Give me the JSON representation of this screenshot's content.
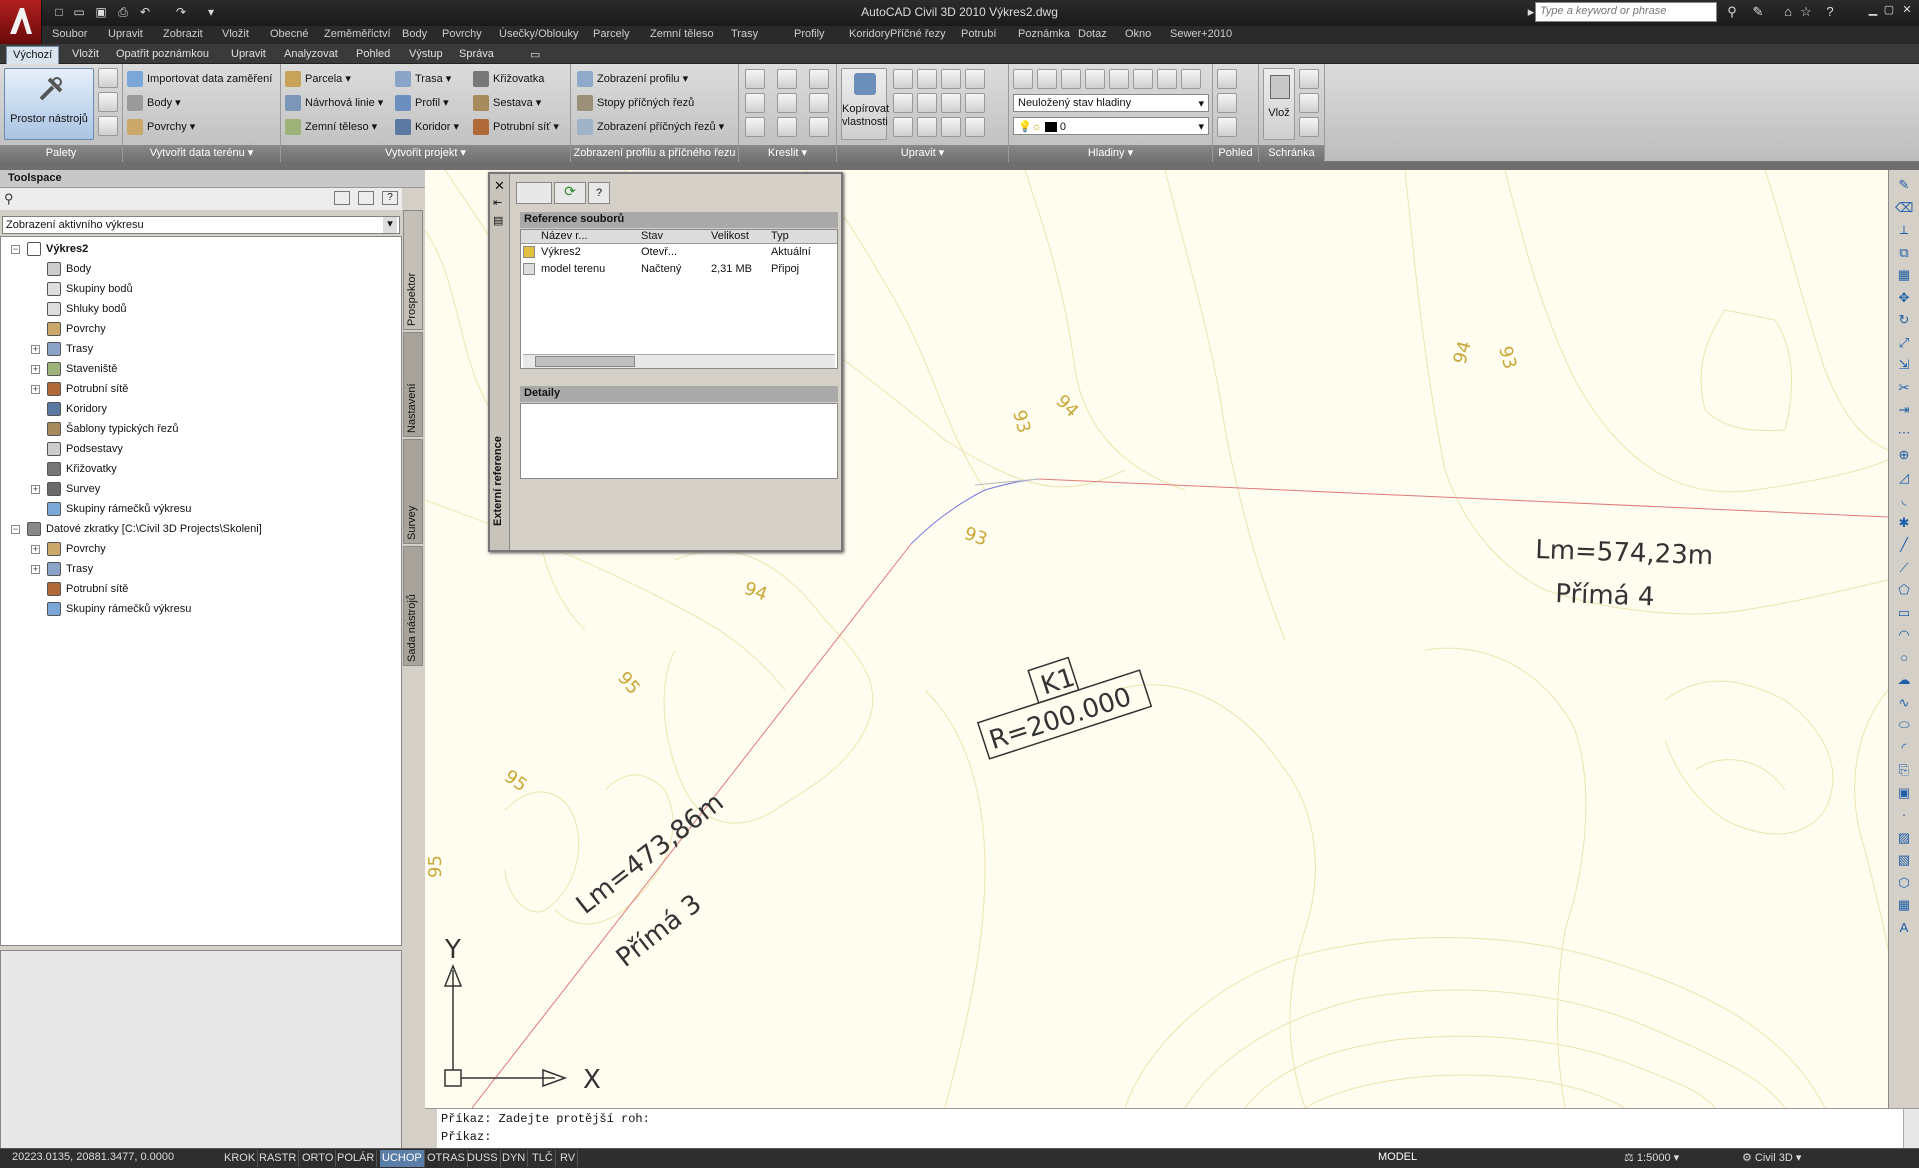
{
  "window": {
    "title": "AutoCAD Civil 3D 2010     Výkres2.dwg",
    "search_placeholder": "Type a keyword or phrase"
  },
  "menubar": [
    "Soubor",
    "Upravit",
    "Zobrazit",
    "Vložit",
    "Obecné",
    "Zeměměřictví",
    "Body",
    "Povrchy",
    "Úsečky/Oblouky",
    "Parcely",
    "Zemní těleso",
    "Trasy",
    "Profily",
    "Koridory",
    "Příčné řezy",
    "Potrubí",
    "Poznámka",
    "Dotaz",
    "Okno",
    "Sewer+2010"
  ],
  "ribbon_tabs": [
    "Výchozí",
    "Vložit",
    "Opatřit poznámkou",
    "Upravit",
    "Analyzovat",
    "Pohled",
    "Výstup",
    "Správa"
  ],
  "ribbon": {
    "palety": {
      "big_button": "Prostor nástrojů",
      "label": "Palety"
    },
    "vytvorit_data": {
      "items": [
        "Importovat data zaměření",
        "Body",
        "Povrchy"
      ],
      "label": "Vytvořit data terénu"
    },
    "vytvorit_projekt": {
      "col1": [
        "Parcela",
        "Návrhová linie",
        "Zemní těleso"
      ],
      "col2": [
        "Trasa",
        "Profil",
        "Koridor"
      ],
      "col3": [
        "Křižovatka",
        "Sestava",
        "Potrubní síť"
      ],
      "label": "Vytvořit projekt"
    },
    "zobrazeni": {
      "items": [
        "Zobrazení profilu",
        "Stopy příčných řezů",
        "Zobrazení příčných řezů"
      ],
      "label": "Zobrazení profilu a příčného řezu"
    },
    "kreslit": {
      "label": "Kreslit"
    },
    "upravit": {
      "copy_props": "Kopírovat vlastnosti",
      "label": "Upravit"
    },
    "hladiny": {
      "state": "Neuložený stav hladiny",
      "layer": "0",
      "label": "Hladiny"
    },
    "pohled": {
      "label": "Pohled"
    },
    "schranka": {
      "paste": "Vlož",
      "label": "Schránka"
    }
  },
  "toolspace": {
    "title": "Toolspace",
    "view_combo": "Zobrazení aktivního výkresu",
    "tabs": [
      "Prospektor",
      "Nastavení",
      "Survey",
      "Sada nástrojů"
    ],
    "tree": [
      {
        "label": "Výkres2",
        "bold": true
      },
      {
        "label": "Body"
      },
      {
        "label": "Skupiny bodů"
      },
      {
        "label": "Shluky bodů"
      },
      {
        "label": "Povrchy"
      },
      {
        "label": "Trasy"
      },
      {
        "label": "Staveniště"
      },
      {
        "label": "Potrubní sítě"
      },
      {
        "label": "Koridory"
      },
      {
        "label": "Šablony typických řezů"
      },
      {
        "label": "Podsestavy"
      },
      {
        "label": "Křižovatky"
      },
      {
        "label": "Survey"
      },
      {
        "label": "Skupiny rámečků výkresu"
      },
      {
        "label": "Datové zkratky [C:\\Civil 3D Projects\\Skoleni]"
      },
      {
        "label": "Povrchy"
      },
      {
        "label": "Trasy"
      },
      {
        "label": "Potrubní sítě"
      },
      {
        "label": "Skupiny rámečků výkresu"
      }
    ]
  },
  "xref": {
    "side_title": "Externí reference",
    "files_header": "Reference souborů",
    "columns": [
      "Název r...",
      "Stav",
      "Velikost",
      "Typ"
    ],
    "rows": [
      {
        "name": "Výkres2",
        "status": "Otevř...",
        "size": "",
        "type": "Aktuální"
      },
      {
        "name": "model terenu",
        "status": "Načtený",
        "size": "2,31 MB",
        "type": "Připoj"
      }
    ],
    "details_header": "Detaily"
  },
  "canvas": {
    "labels": {
      "lm1": "Lm=574,23m",
      "prima4": "Přímá 4",
      "k1": "K1",
      "radius": "R=200.000",
      "lm2": "Lm=473,86m",
      "prima3": "Přímá 3",
      "c93a": "93",
      "c94a": "94",
      "c93b": "93",
      "c94b": "94",
      "c94c": "94",
      "c93c": "93",
      "c95a": "95",
      "c95b": "95",
      "c95c": "95",
      "axis_y": "Y",
      "axis_x": "X"
    }
  },
  "command": {
    "line1": "Příkaz: Zadejte protější roh:",
    "line2": "Příkaz:"
  },
  "status": {
    "coords": "20223.0135, 20881.3477, 0.0000",
    "toggles": [
      "KROK",
      "RASTR",
      "ORTO",
      "POLÁR",
      "UCHOP",
      "OTRAS",
      "DUSS",
      "DYN",
      "TLČ",
      "RV"
    ],
    "model": "MODEL",
    "scale": "1:5000",
    "workspace": "Civil 3D"
  }
}
